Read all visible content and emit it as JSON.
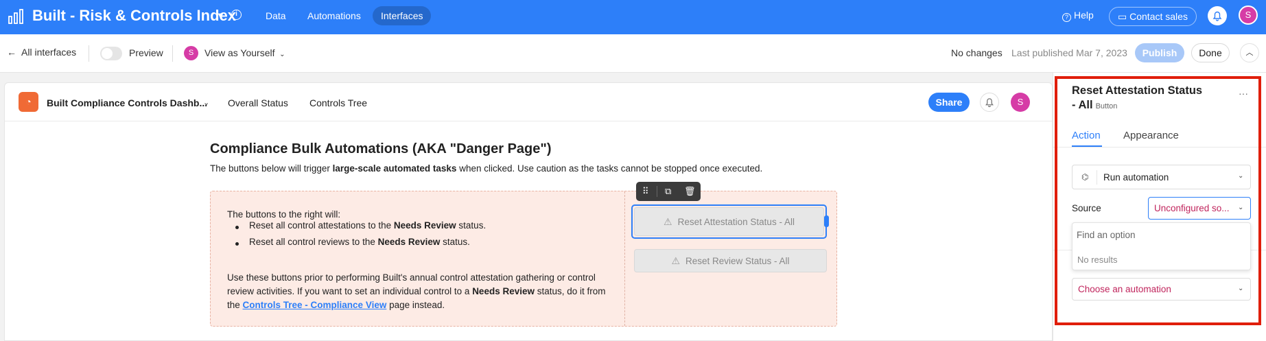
{
  "app": {
    "title": "Built - Risk & Controls Index",
    "nav": [
      "Data",
      "Automations",
      "Interfaces"
    ],
    "active_nav": "Interfaces",
    "help": "Help",
    "contact_sales": "Contact sales",
    "user_initial": "S",
    "brand_color": "#2d7ff9"
  },
  "toolbar": {
    "back": "All interfaces",
    "preview": "Preview",
    "view_as": "View as Yourself",
    "user_initial": "S",
    "no_changes": "No changes",
    "last_published": "Last published Mar 7, 2023",
    "publish": "Publish",
    "done": "Done"
  },
  "interface": {
    "name": "Built Compliance Controls Dashb...",
    "tabs": [
      "Overall Status",
      "Controls Tree"
    ],
    "share": "Share",
    "user_initial": "S"
  },
  "page": {
    "title": "Compliance Bulk Automations (AKA \"Danger Page\")",
    "desc_before": "The buttons below will trigger ",
    "desc_bold": "large-scale automated tasks",
    "desc_after": " when clicked. Use caution as the tasks cannot be stopped once executed.",
    "box": {
      "intro": "The buttons to the right will:",
      "bullet1_before": "Reset all control attestations to the ",
      "bullet1_bold": "Needs Review",
      "bullet1_after": " status.",
      "bullet2_before": "Reset all control reviews to the ",
      "bullet2_bold": "Needs Review",
      "bullet2_after": " status.",
      "para_line1": "Use these buttons prior to performing Built's annual control attestation gathering or control",
      "para_line2_before": "review activities. If you want to set an individual control to a ",
      "para_line2_bold": "Needs Review",
      "para_line2_after": " status, do it from",
      "para_line3_before": "the ",
      "para_line3_link": "Controls Tree - Compliance View",
      "para_line3_after": " page instead."
    },
    "buttons": [
      "Reset Attestation Status - All",
      "Reset Review Status - All"
    ]
  },
  "panel": {
    "title": "Reset Attestation Status - All",
    "type": "Button",
    "tabs": [
      "Action",
      "Appearance"
    ],
    "active_tab": "Action",
    "action": "Run automation",
    "source_label": "Source",
    "source_value": "Unconfigured so...",
    "search_placeholder": "Find an option",
    "no_results": "No results",
    "automation": "Choose an automation"
  }
}
